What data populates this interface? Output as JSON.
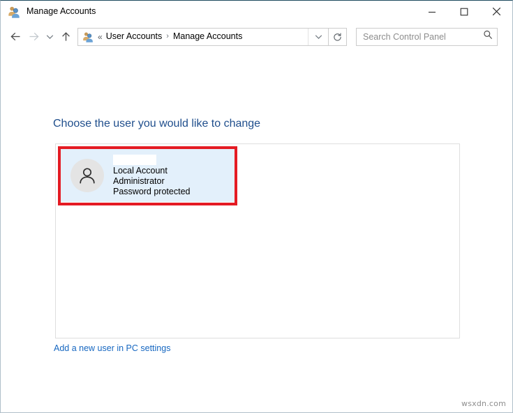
{
  "window": {
    "title": "Manage Accounts",
    "app_icon": "user-accounts-icon",
    "controls": {
      "minimize_label": "Minimize",
      "maximize_label": "Maximize",
      "close_label": "Close"
    }
  },
  "navbar": {
    "back_label": "Back",
    "forward_label": "Forward",
    "recent_label": "Recent locations",
    "up_label": "Up one level",
    "breadcrumb_icon": "user-accounts-icon",
    "breadcrumb_prefix": "«",
    "breadcrumb": [
      {
        "label": "User Accounts"
      },
      {
        "label": "Manage Accounts"
      }
    ],
    "separator": "›",
    "dropdown_label": "Previous locations",
    "refresh_label": "Refresh"
  },
  "search": {
    "placeholder": "Search Control Panel",
    "value": "",
    "icon": "search-icon"
  },
  "main": {
    "page_title": "Choose the user you would like to change",
    "accounts": [
      {
        "avatar_icon": "user-avatar-icon",
        "username": "",
        "account_type": "Local Account",
        "role": "Administrator",
        "password_status": "Password protected",
        "selected": true,
        "highlighted": true
      }
    ],
    "add_user_link": "Add a new user in PC settings"
  },
  "annotation": {
    "highlight_color": "#e41b23",
    "shape": "rectangle"
  },
  "colors": {
    "accent_blue": "#1f4e8c",
    "link_blue": "#1667c1",
    "selection_blue": "#e3f0fb",
    "highlight_red": "#e41b23"
  },
  "watermark": {
    "text": "wsxdn.com"
  }
}
